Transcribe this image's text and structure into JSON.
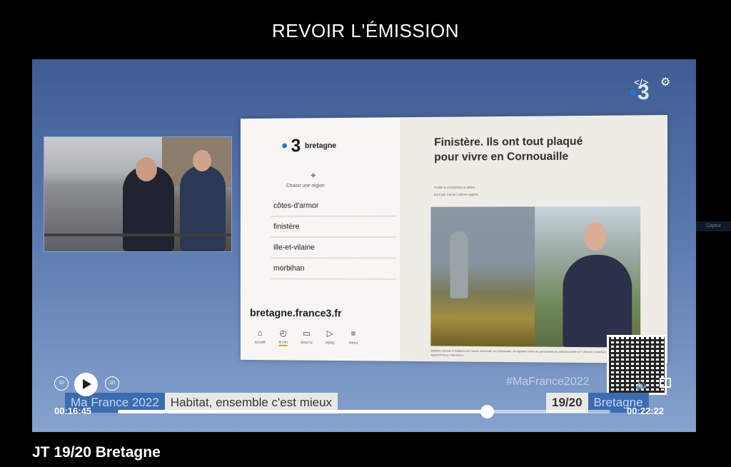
{
  "header": {
    "title": "REVOIR L'ÉMISSION"
  },
  "site": {
    "brand_num": "3",
    "brand_name": "bretagne",
    "choose_region": "Choisir une région",
    "regions": [
      "côtes-d'armor",
      "finistère",
      "ille-et-vilaine",
      "morbihan"
    ],
    "domain": "bretagne.france3.fr",
    "nav": [
      {
        "label": "accueil",
        "icon": "home-icon"
      },
      {
        "label": "fil info",
        "icon": "clock-icon"
      },
      {
        "label": "direct tv",
        "icon": "tv-icon"
      },
      {
        "label": "replay",
        "icon": "play-icon"
      },
      {
        "label": "menu",
        "icon": "menu-icon"
      }
    ],
    "article_title": "Finistère. Ils ont tout plaqué pour vivre en Cornouaille",
    "published": "Publié le 21/03/2022 à 18h04",
    "written_by": "Écrit par Carole Collinet-Appéré",
    "caption": "Matthieu Homek et Natacha De France ont trouvé, en Cornouaille, un équilibre entre vie personnelle et professionnelle ● © Vincent Coulichet et Carole Collinet-Appéré/France Télévisions"
  },
  "overlay": {
    "hashtag": "#MaFrance2022",
    "channel_logo": "3",
    "program": "Ma France 2022",
    "subtitle": "Habitat, ensemble c'est mieux",
    "news_time": "19/20",
    "region": "Bretagne",
    "side_tab": "Captur"
  },
  "controls": {
    "rewind_label": "10",
    "forward_label": "10",
    "current_time": "00:16:45",
    "total_time": "00:22:22",
    "progress": 0.749
  },
  "video_title": "JT 19/20 Bretagne"
}
